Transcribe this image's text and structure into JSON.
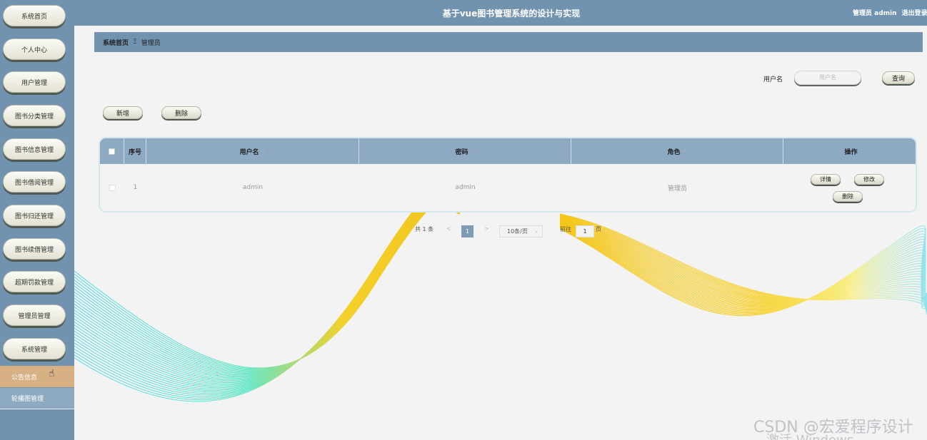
{
  "header": {
    "title": "基于vue图书管理系统的设计与实现",
    "user": "管理员 admin",
    "logout": "退出登录"
  },
  "sidebar": {
    "items": [
      {
        "label": "系统首页"
      },
      {
        "label": "个人中心"
      },
      {
        "label": "用户管理"
      },
      {
        "label": "图书分类管理"
      },
      {
        "label": "图书信息管理"
      },
      {
        "label": "图书借阅管理"
      },
      {
        "label": "图书归还管理"
      },
      {
        "label": "图书续借管理"
      },
      {
        "label": "超期罚款管理"
      },
      {
        "label": "管理员管理"
      },
      {
        "label": "系统管理"
      }
    ],
    "subitems": [
      {
        "label": "公告信息"
      },
      {
        "label": "轮播图管理"
      }
    ]
  },
  "breadcrumb": {
    "home": "系统首页",
    "separator": "Ξ",
    "current": "管理员"
  },
  "search": {
    "label": "用户名",
    "placeholder": "用户名",
    "button": "查询"
  },
  "actions": {
    "add": "新增",
    "delete": "删除"
  },
  "table": {
    "columns": {
      "index": "序号",
      "username": "用户名",
      "password": "密码",
      "role": "角色",
      "ops": "操作"
    },
    "sort_icon": "⇕",
    "rows": [
      {
        "index": "1",
        "username": "admin",
        "password": "admin",
        "role": "管理员",
        "detail": "详情",
        "edit": "修改",
        "delete": "删除"
      }
    ]
  },
  "pagination": {
    "total": "共 1 条",
    "prev": "<",
    "current_page": "1",
    "next": ">",
    "page_size": "10条/页",
    "goto_label": "前往",
    "goto_value": "1",
    "page_suffix": "页"
  },
  "watermark": {
    "text": "CSDN @宏爱程序设计",
    "activate": "激活 Windows"
  },
  "colors": {
    "primary": "#7193b0",
    "table_head": "#8ea9c2",
    "active_sub": "#d7b083"
  }
}
